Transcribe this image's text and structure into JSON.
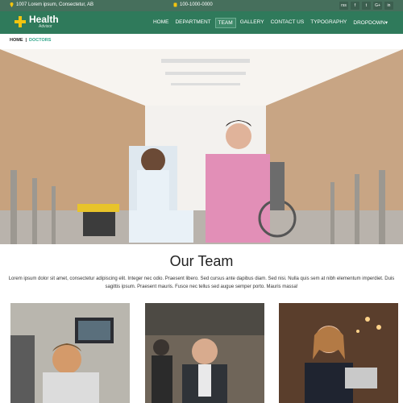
{
  "topbar": {
    "address": "1007 Lorem ipsum, Consectetur, AB",
    "phone": "100-1000-0000",
    "socials": [
      {
        "label": "rss",
        "icon": "rss-icon"
      },
      {
        "label": "f",
        "icon": "facebook-icon"
      },
      {
        "label": "t",
        "icon": "twitter-icon"
      },
      {
        "label": "G+",
        "icon": "google-plus-icon"
      },
      {
        "label": "in",
        "icon": "linkedin-icon"
      }
    ]
  },
  "brand": {
    "name": "Health",
    "tagline": "Advisor"
  },
  "nav": {
    "items": [
      "HOME",
      "DEPARTMENT",
      "TEAM",
      "GALLERY",
      "CONTACT US",
      "TYPOGRAPHY",
      "DROPDOWN▾"
    ],
    "active": "TEAM"
  },
  "breadcrumb": {
    "home": "HOME",
    "separator": "|",
    "current": "DOCTORS"
  },
  "section": {
    "title": "Our Team",
    "text": "Lorem ipsum dolor sit amet, consectetur adipiscing elit. Integer nec odio. Praesent libero. Sed cursus ante dapibus diam. Sed nisi. Nulla quis sem at nibh elementum imperdiet. Duis sagittis ipsum. Praesent mauris. Fusce nec tellus sed augue semper porto. Mauris massa!"
  },
  "colors": {
    "nav": "#2f7a5b",
    "topbar": "#466f5c",
    "accent": "#2fa58a",
    "logo": "#f2c40f"
  }
}
